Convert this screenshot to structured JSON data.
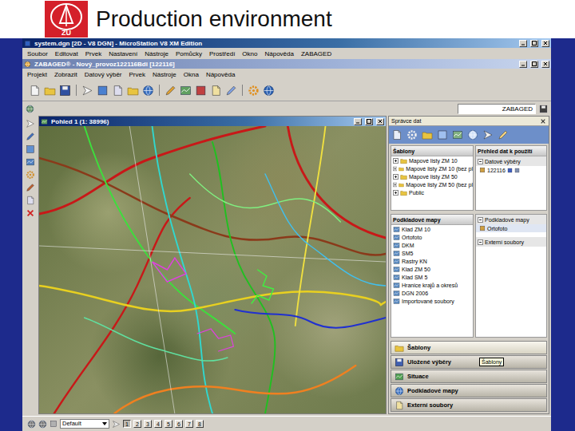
{
  "slide": {
    "title": "Production environment",
    "logo": "ZÚ"
  },
  "window": {
    "title": "system.dgn [2D - V8 DGN] - MicroStation V8 XM Edition"
  },
  "menu": [
    "Soubor",
    "Editovat",
    "Prvek",
    "Nastavení",
    "Nástroje",
    "Pomůcky",
    "Prostředí",
    "Okno",
    "Nápověda",
    "ZABAGED"
  ],
  "app_window": {
    "title": "ZABAGED® - Nový_provoz122116Bdi [122116]"
  },
  "app_menu": [
    "Projekt",
    "Zobrazit",
    "Datový výběr",
    "Prvek",
    "Nástroje",
    "Okna",
    "Nápověda"
  ],
  "level_field": {
    "value": "ZABAGED"
  },
  "view": {
    "title": "Pohled 1 (1: 38996)"
  },
  "data_manager": {
    "title": "Správce dat",
    "templates": {
      "title": "Šablony",
      "items": [
        {
          "label": "Mapové listy ZM 10",
          "expanded": false
        },
        {
          "label": "Mapové listy ZM 10 (bez pl",
          "expanded": false
        },
        {
          "label": "Mapové listy ZM 50",
          "expanded": false
        },
        {
          "label": "Mapové listy ZM 50 (bez pl",
          "expanded": false
        },
        {
          "label": "Public",
          "expanded": false
        }
      ]
    },
    "overview": {
      "title": "Přehled dat k použití",
      "groups": [
        {
          "label": "Datové výběry",
          "expanded": true,
          "items": [
            "122116"
          ]
        }
      ]
    },
    "base_maps": {
      "title": "Podkladové mapy",
      "items": [
        "Klad ZM 10",
        "Ortofoto",
        "DKM",
        "SM5",
        "Rastry KN",
        "Klad ZM 50",
        "Klad SM 5",
        "Hranice krajů a okresů",
        "DGN 2006",
        "Importované soubory"
      ]
    },
    "used_sections": [
      {
        "label": "Podkladové mapy",
        "expanded": true,
        "items": [
          "Ortofoto"
        ]
      },
      {
        "label": "Externí soubory",
        "expanded": true,
        "items": []
      }
    ]
  },
  "nav_buttons": [
    {
      "label": "Šablony",
      "selected": true
    },
    {
      "label": "Uložené výběry",
      "selected": false
    },
    {
      "label": "Situace",
      "selected": false
    },
    {
      "label": "Podkladové mapy",
      "selected": false
    },
    {
      "label": "Externí soubory",
      "selected": false
    }
  ],
  "tooltip": {
    "text": "Šablony"
  },
  "view_bar": {
    "view_set": "Default",
    "views": [
      {
        "label": "1",
        "selected": true
      },
      {
        "label": "2",
        "selected": false
      },
      {
        "label": "3",
        "selected": false
      },
      {
        "label": "4",
        "selected": false
      },
      {
        "label": "5",
        "selected": false
      },
      {
        "label": "6",
        "selected": false
      },
      {
        "label": "7",
        "selected": false
      },
      {
        "label": "8",
        "selected": false
      }
    ]
  }
}
